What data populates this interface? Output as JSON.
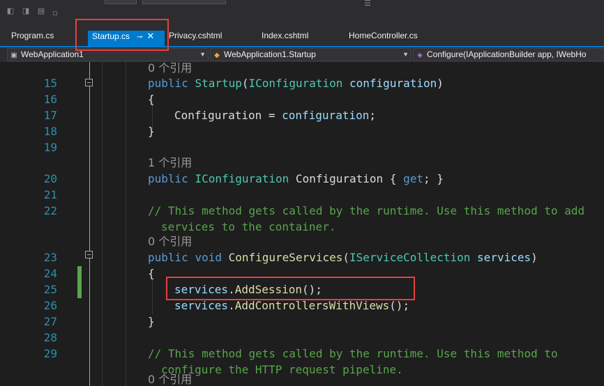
{
  "toolbar": {
    "icons": [
      "bookmark-icon",
      "bookmark-prev-icon",
      "bookmark-next-icon",
      "bookmark-clear-icon",
      "comment-icon"
    ]
  },
  "tabs": [
    {
      "label": "Program.cs",
      "active": false
    },
    {
      "label": "Startup.cs",
      "active": true,
      "pin": "⊸",
      "close": "✕"
    },
    {
      "label": "Privacy.cshtml",
      "active": false
    },
    {
      "label": "Index.cshtml",
      "active": false
    },
    {
      "label": "HomeController.cs",
      "active": false
    }
  ],
  "navbar": {
    "project": "WebApplication1",
    "class": "WebApplication1.Startup",
    "member": "Configure(IApplicationBuilder app, IWebHo"
  },
  "code": {
    "ref0": "0 个引用",
    "ref1": "1 个引用",
    "ref2": "0 个引用",
    "ref3": "0 个引用",
    "lines": {
      "l15": {
        "num": "15",
        "kw": "public",
        "type": "Startup",
        "p1": "(",
        "type2": "IConfiguration",
        "sp": " ",
        "param": "configuration",
        "p2": ")"
      },
      "l16": {
        "num": "16",
        "text": "{"
      },
      "l17": {
        "num": "17",
        "lhs": "Configuration = ",
        "rhs": "configuration",
        "end": ";"
      },
      "l18": {
        "num": "18",
        "text": "}"
      },
      "l19": {
        "num": "19"
      },
      "l20": {
        "num": "20",
        "kw": "public",
        "type": "IConfiguration",
        "name": " Configuration { ",
        "get": "get",
        "end": "; }"
      },
      "l21": {
        "num": "21"
      },
      "l22": {
        "num": "22",
        "comment1": "// This method gets called by the runtime. Use this method to add",
        "comment2": "services to the container."
      },
      "l23": {
        "num": "23",
        "kw": "public",
        "kw2": "void",
        "fn": "ConfigureServices",
        "p1": "(",
        "type": "IServiceCollection",
        "param": "services",
        "p2": ")"
      },
      "l24": {
        "num": "24",
        "text": "{"
      },
      "l25": {
        "num": "25",
        "obj": "services",
        "dot": ".",
        "fn": "AddSession",
        "end": "();"
      },
      "l26": {
        "num": "26",
        "obj": "services",
        "dot": ".",
        "fn": "AddControllersWithViews",
        "end": "();"
      },
      "l27": {
        "num": "27",
        "text": "}"
      },
      "l28": {
        "num": "28"
      },
      "l29": {
        "num": "29",
        "comment1": "// This method gets called by the runtime. Use this method to",
        "comment2": "configure the HTTP request pipeline."
      }
    }
  },
  "colors": {
    "accent": "#007acc",
    "highlight": "#e74040",
    "changed": "#57a64a"
  }
}
